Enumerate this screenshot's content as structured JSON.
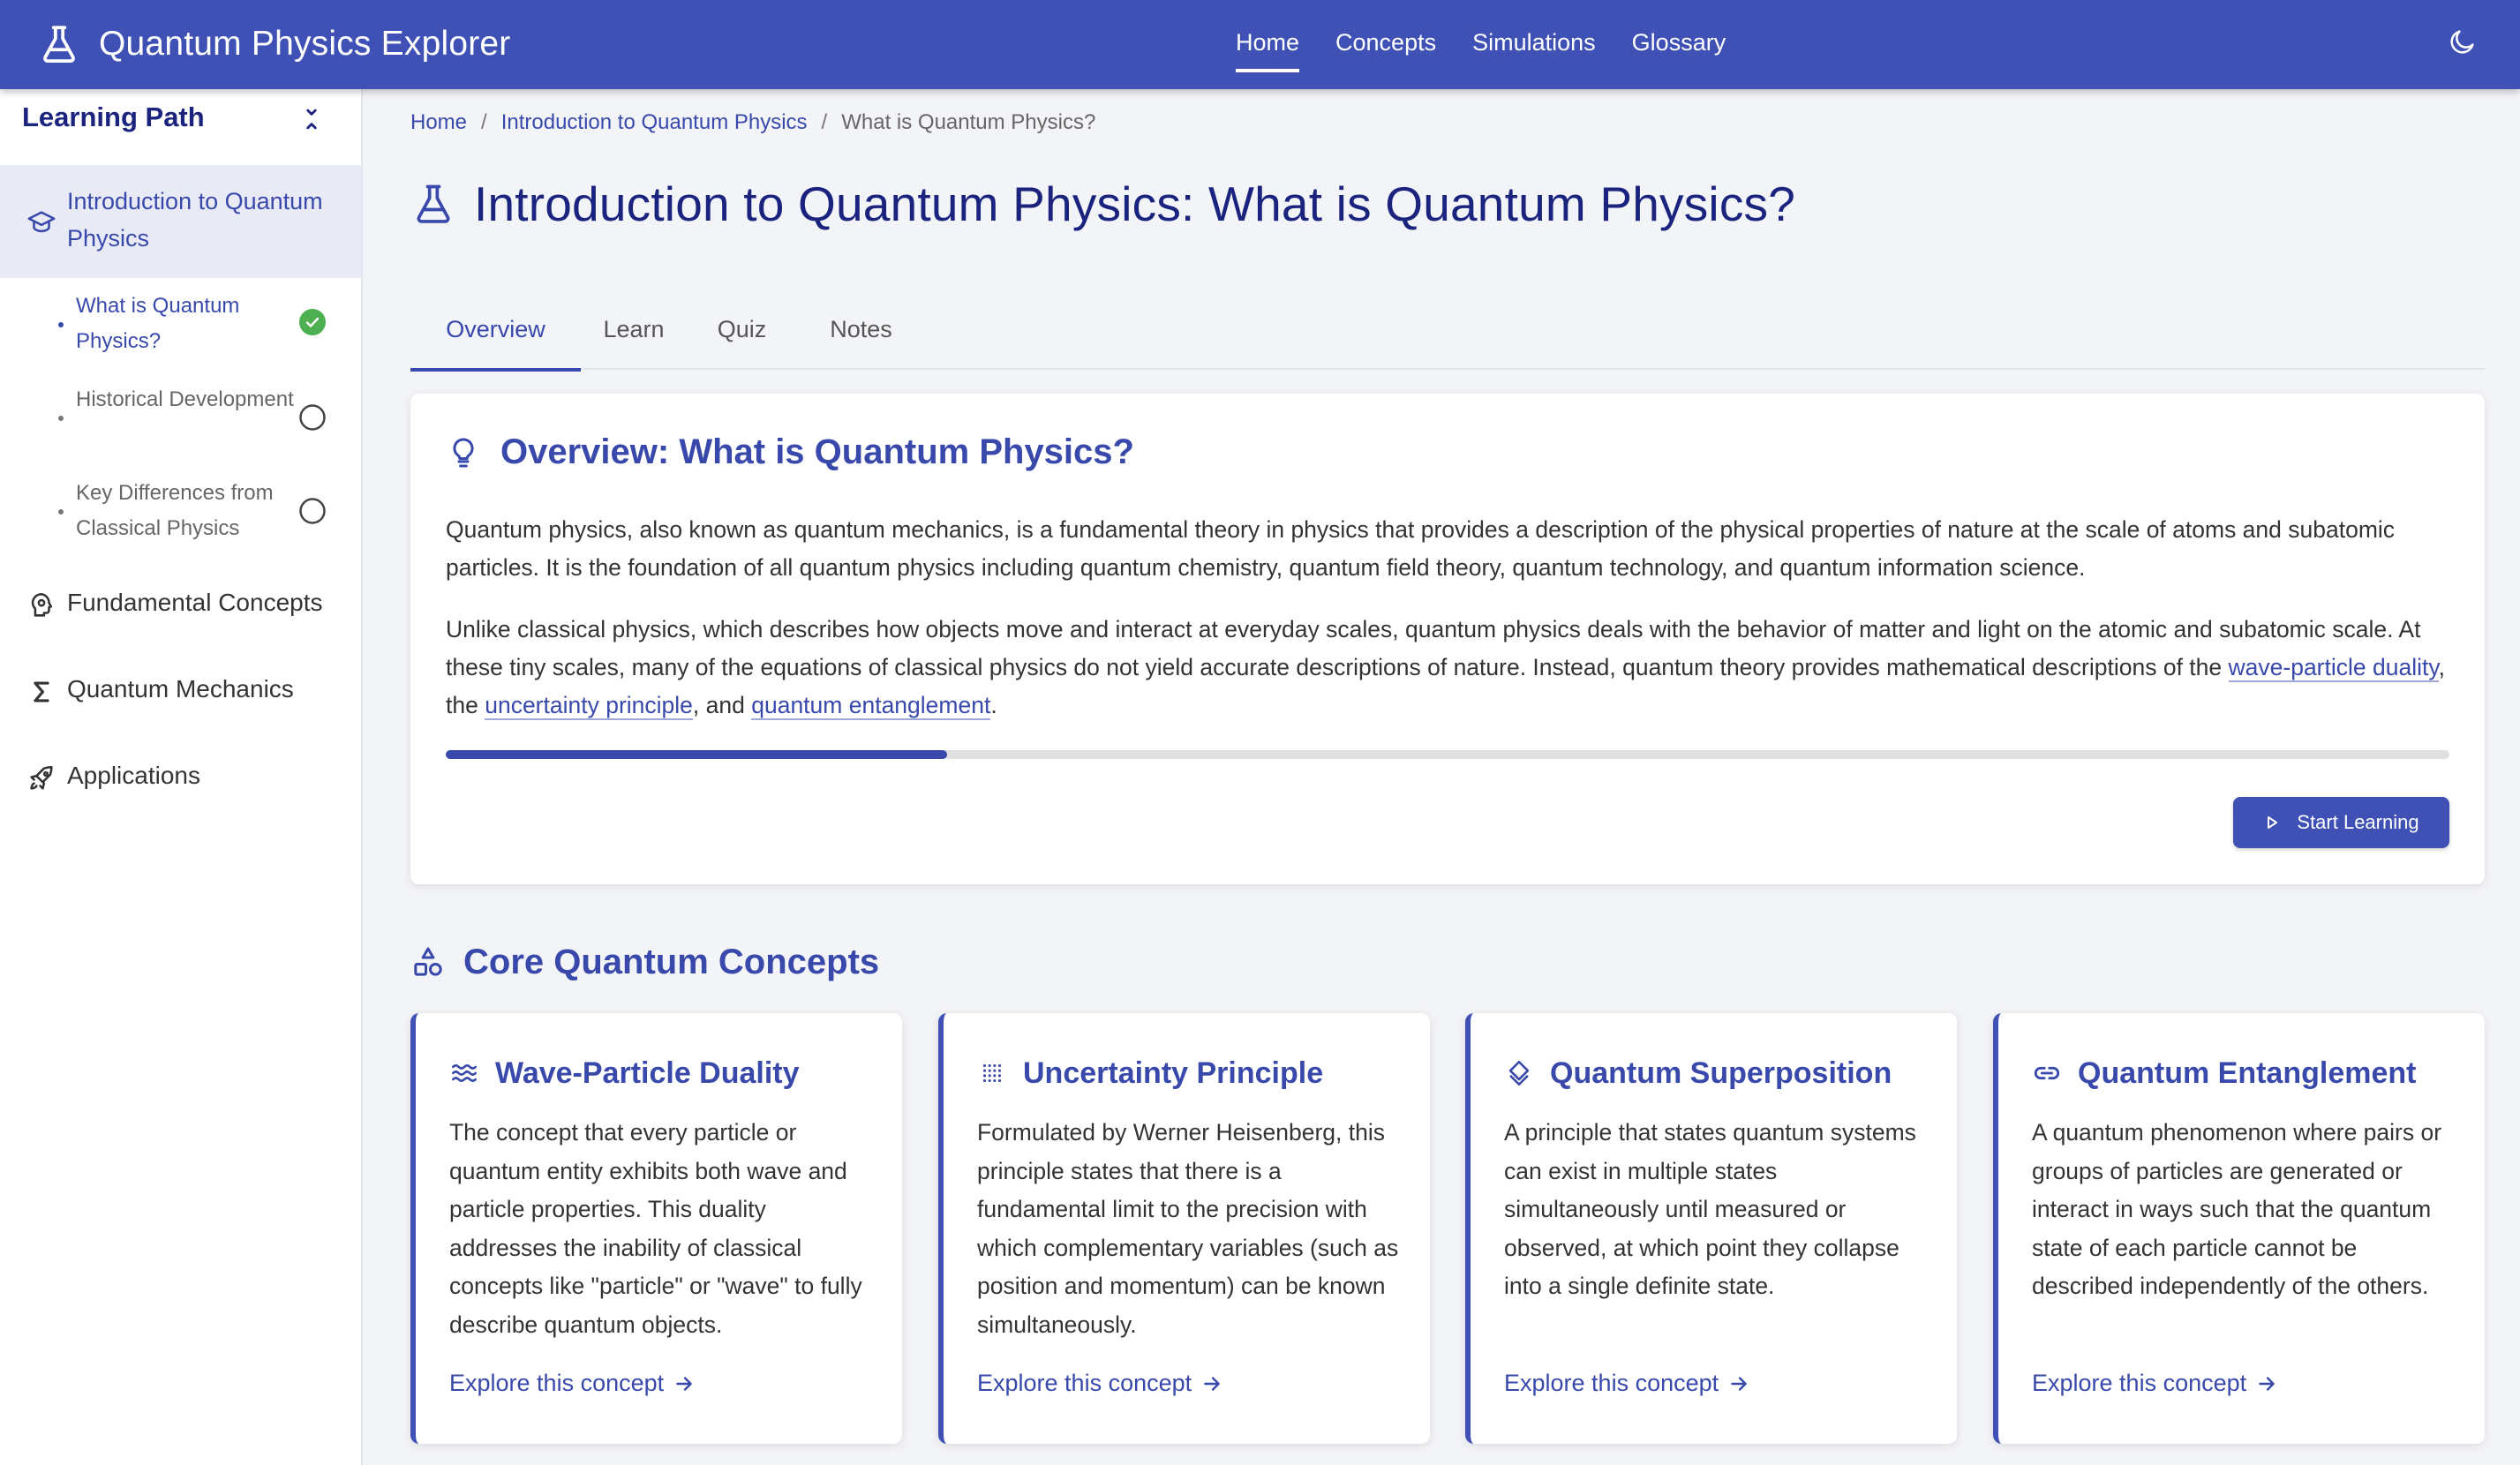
{
  "app": {
    "title": "Quantum Physics Explorer",
    "icon": "flask-icon",
    "accent_color": "#3f51b5"
  },
  "nav": {
    "items": [
      {
        "label": "Home",
        "active": true
      },
      {
        "label": "Concepts",
        "active": false
      },
      {
        "label": "Simulations",
        "active": false
      },
      {
        "label": "Glossary",
        "active": false
      }
    ],
    "theme_toggle_icon": "moon-icon"
  },
  "sidebar": {
    "title": "Learning Path",
    "collapse_icon": "collapse-chevrons-icon",
    "sections": [
      {
        "label": "Introduction to Quantum Physics",
        "icon": "graduation-cap-icon",
        "expanded": true,
        "lessons": [
          {
            "label": "What is Quantum Physics?",
            "status": "completed"
          },
          {
            "label": "Historical Development",
            "status": "not-started"
          },
          {
            "label": "Key Differences from Classical Physics",
            "status": "not-started"
          }
        ]
      },
      {
        "label": "Fundamental Concepts",
        "icon": "brain-icon"
      },
      {
        "label": "Quantum Mechanics",
        "icon": "sigma-icon"
      },
      {
        "label": "Applications",
        "icon": "rocket-icon"
      }
    ]
  },
  "breadcrumb": {
    "items": [
      "Home",
      "Introduction to Quantum Physics"
    ],
    "current": "What is Quantum Physics?",
    "separator": "/"
  },
  "page": {
    "title": "Introduction to Quantum Physics: What is Quantum Physics?",
    "icon": "flask-icon"
  },
  "tabs": [
    {
      "label": "Overview",
      "active": true
    },
    {
      "label": "Learn",
      "active": false
    },
    {
      "label": "Quiz",
      "active": false
    },
    {
      "label": "Notes",
      "active": false
    }
  ],
  "overview": {
    "title": "Overview: What is Quantum Physics?",
    "icon": "lightbulb-icon",
    "paragraph1": "Quantum physics, also known as quantum mechanics, is a fundamental theory in physics that provides a description of the physical properties of nature at the scale of atoms and subatomic particles. It is the foundation of all quantum physics including quantum chemistry, quantum field theory, quantum technology, and quantum information science.",
    "paragraph2_text": "Unlike classical physics, which describes how objects move and interact at everyday scales, quantum physics deals with the behavior of matter and light on the atomic and subatomic scale. At these tiny scales, many of the equations of classical physics do not yield accurate descriptions of nature. Instead, quantum theory provides mathematical descriptions of the",
    "links": [
      "wave-particle duality",
      "uncertainty principle",
      "quantum entanglement"
    ],
    "joiner1": ", the",
    "joiner2": ", and",
    "ending": ".",
    "progress": 0.25,
    "button_label": "Start Learning",
    "button_icon": "play-icon"
  },
  "core": {
    "title": "Core Quantum Concepts",
    "icon": "shapes-icon",
    "cards": [
      {
        "title": "Wave-Particle Duality",
        "icon": "waves-icon",
        "description": "The concept that every particle or quantum entity exhibits both wave and particle properties. This duality addresses the inability of classical concepts like \"particle\" or \"wave\" to fully describe quantum objects.",
        "link": "Explore this concept"
      },
      {
        "title": "Uncertainty Principle",
        "icon": "dot-grid-icon",
        "description": "Formulated by Werner Heisenberg, this principle states that there is a fundamental limit to the precision with which complementary variables (such as position and momentum) can be known simultaneously.",
        "link": "Explore this concept"
      },
      {
        "title": "Quantum Superposition",
        "icon": "layers-icon",
        "description": "A principle that states quantum systems can exist in multiple states simultaneously until measured or observed, at which point they collapse into a single definite state.",
        "link": "Explore this concept"
      },
      {
        "title": "Quantum Entanglement",
        "icon": "link-icon",
        "description": "A quantum phenomenon where pairs or groups of particles are generated or interact in ways such that the quantum state of each particle cannot be described independently of the others.",
        "link": "Explore this concept"
      }
    ]
  }
}
